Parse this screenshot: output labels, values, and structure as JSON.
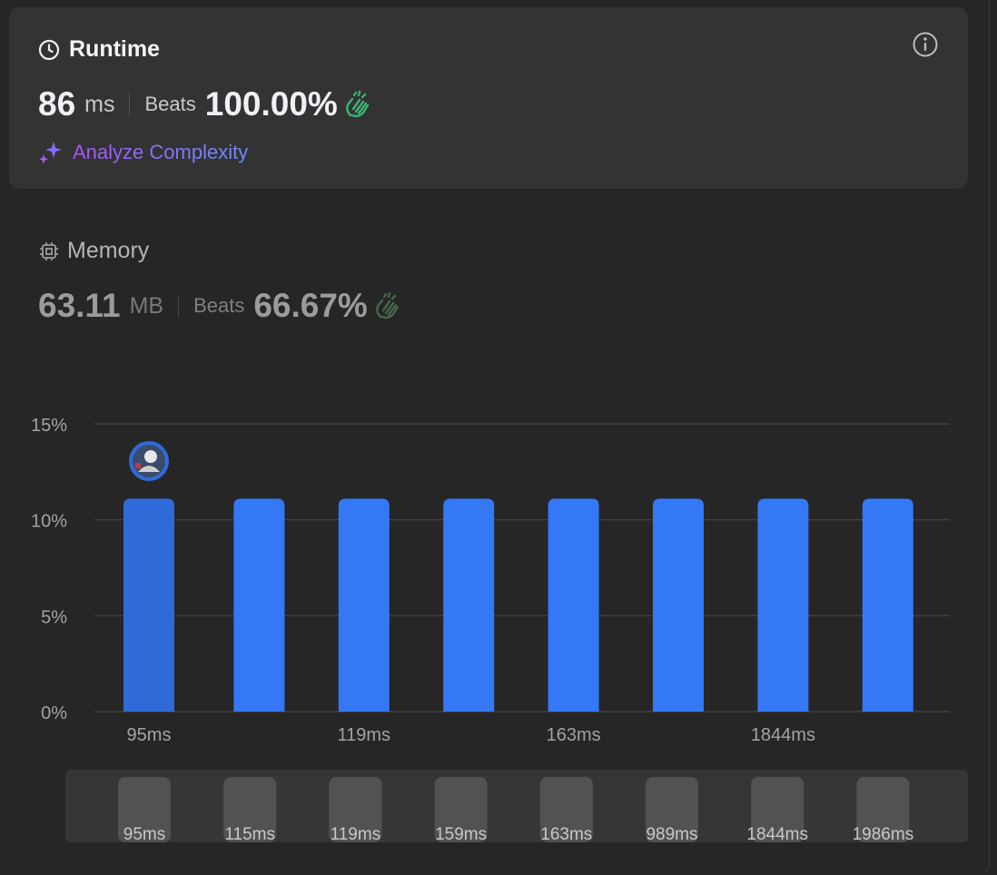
{
  "runtime": {
    "title": "Runtime",
    "value": "86",
    "unit": "ms",
    "beats_label": "Beats",
    "beats_value": "100.00%",
    "analyze_label": "Analyze Complexity"
  },
  "memory": {
    "title": "Memory",
    "value": "63.11",
    "unit": "MB",
    "beats_label": "Beats",
    "beats_value": "66.67%"
  },
  "icons": {
    "runtime": "clock-icon",
    "info": "info-icon",
    "clap": "clapping-hands-icon",
    "analyze": "sparkle-icon",
    "memory": "cpu-chip-icon"
  },
  "colors": {
    "bar": "#3478f6",
    "bar_selected": "#2f6ad9",
    "clap_active": "#3cb371",
    "analyze_start": "#a855f7",
    "analyze_end": "#6b8cff"
  },
  "chart_data": {
    "type": "bar",
    "categories": [
      "95ms",
      "115ms",
      "119ms",
      "159ms",
      "163ms",
      "989ms",
      "1844ms",
      "1986ms"
    ],
    "values": [
      11.1,
      11.1,
      11.1,
      11.1,
      11.1,
      11.1,
      11.1,
      11.1
    ],
    "yticks": [
      "0%",
      "5%",
      "10%",
      "15%"
    ],
    "ylim": [
      0,
      15
    ],
    "xtick_labels": [
      "95ms",
      "119ms",
      "163ms",
      "1844ms"
    ],
    "selected_index": 0,
    "grid": true
  },
  "scrubber": {
    "labels": [
      "95ms",
      "115ms",
      "119ms",
      "159ms",
      "163ms",
      "989ms",
      "1844ms",
      "1986ms"
    ]
  }
}
